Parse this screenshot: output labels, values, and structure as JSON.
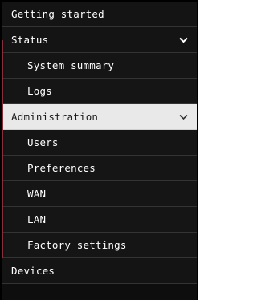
{
  "nav": {
    "getting_started": "Getting started",
    "status": {
      "label": "Status",
      "icon": "chevron-down-icon",
      "items": [
        "System summary",
        "Logs"
      ]
    },
    "administration": {
      "label": "Administration",
      "icon": "chevron-down-icon",
      "items": [
        "Users",
        "Preferences",
        "WAN",
        "LAN",
        "Factory settings"
      ]
    },
    "devices": "Devices"
  },
  "colors": {
    "background": "#0e0e0e",
    "text": "#ffffff",
    "active_background": "#e9e9e9",
    "active_text": "#1a1a1a",
    "accent_line": "#c0162b"
  }
}
